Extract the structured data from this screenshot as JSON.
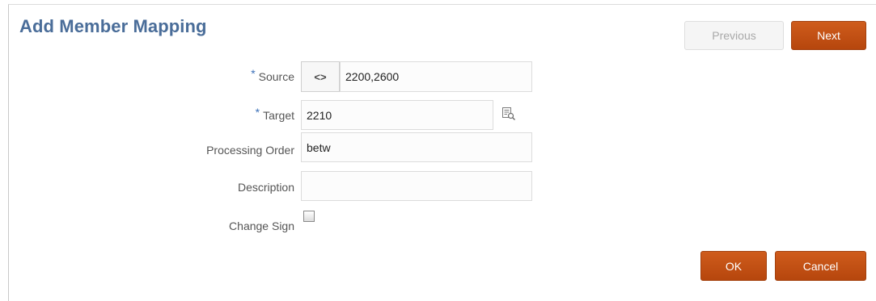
{
  "dialog": {
    "title": "Add Member Mapping"
  },
  "nav": {
    "previous_label": "Previous",
    "next_label": "Next"
  },
  "form": {
    "required_mark": "*",
    "source": {
      "label": "Source",
      "toggle_glyph": "<>",
      "value": "2200,2600"
    },
    "target": {
      "label": "Target",
      "value": "2210"
    },
    "processing_order": {
      "label": "Processing Order",
      "value": "betw"
    },
    "description": {
      "label": "Description",
      "value": ""
    },
    "change_sign": {
      "label": "Change Sign",
      "checked": false
    }
  },
  "footer": {
    "ok_label": "OK",
    "cancel_label": "Cancel"
  },
  "colors": {
    "title": "#4a6d99",
    "primary_button": "#c2500f",
    "required_mark": "#3c71b8"
  },
  "icons": {
    "source_toggle": "code-brackets-icon",
    "target_lookup": "member-selector-icon"
  }
}
